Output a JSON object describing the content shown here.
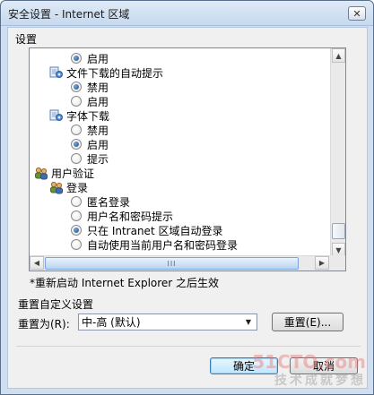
{
  "window": {
    "title": "安全设置 - Internet 区域",
    "close_glyph": "✕"
  },
  "settings_group_label": "设置",
  "tree_items": [
    {
      "type": "radio",
      "label": "启用",
      "checked": true
    },
    {
      "type": "folder",
      "label": "文件下载的自动提示",
      "icon": "settings-icon"
    },
    {
      "type": "radio",
      "label": "禁用",
      "checked": true
    },
    {
      "type": "radio",
      "label": "启用",
      "checked": false
    },
    {
      "type": "folder",
      "label": "字体下载",
      "icon": "settings-icon"
    },
    {
      "type": "radio",
      "label": "禁用",
      "checked": false
    },
    {
      "type": "radio",
      "label": "启用",
      "checked": true
    },
    {
      "type": "radio",
      "label": "提示",
      "checked": false
    },
    {
      "type": "folder",
      "label": "用户验证",
      "icon": "users-icon"
    },
    {
      "type": "folder",
      "label": "登录",
      "icon": "users-icon"
    },
    {
      "type": "radio",
      "label": "匿名登录",
      "checked": false
    },
    {
      "type": "radio",
      "label": "用户名和密码提示",
      "checked": false
    },
    {
      "type": "radio",
      "label": "只在 Intranet 区域自动登录",
      "checked": true
    },
    {
      "type": "radio",
      "label": "自动使用当前用户名和密码登录",
      "checked": false
    }
  ],
  "scroll": {
    "vertical_position": 0.92,
    "up_glyph": "▲",
    "down_glyph": "▼",
    "left_glyph": "◀",
    "right_glyph": "▶",
    "thumb_grip": "III"
  },
  "restart_note": "*重新启动 Internet Explorer 之后生效",
  "reset": {
    "group_title": "重置自定义设置",
    "label": "重置为(R):",
    "selected": "中-高 (默认)",
    "button": "重置(E)..."
  },
  "buttons": {
    "ok": "确定",
    "cancel": "取消"
  },
  "watermark": {
    "top": "51CTO.com",
    "bottom": "技术成就梦想"
  }
}
